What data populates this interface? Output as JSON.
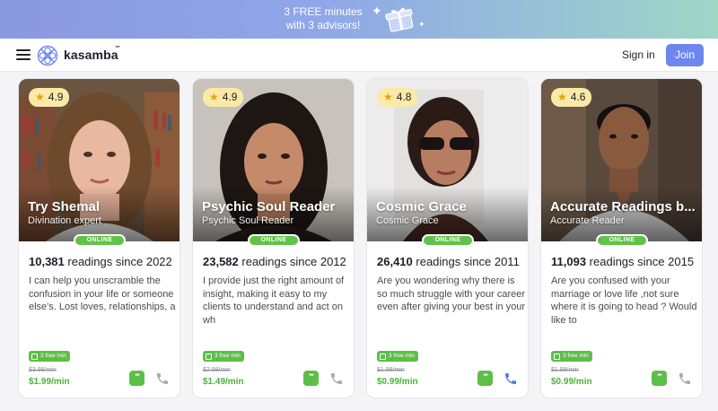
{
  "promo": {
    "line1": "3 FREE minutes",
    "line2": "with 3 advisors!"
  },
  "header": {
    "brand": "kasamba",
    "trademark": "™",
    "signin": "Sign in",
    "join": "Join"
  },
  "online_label": "ONLINE",
  "readings_suffix": "readings since",
  "free_label": "3 free min",
  "colors": {
    "accent": "#6e86ef",
    "online": "#62c14a",
    "price": "#4ab33a",
    "rating_bg": "#fbe9a8",
    "phone_active": "#4f79e8",
    "phone_inactive": "#a7a7ae"
  },
  "advisors": [
    {
      "rating": "4.9",
      "name": "Try Shemal",
      "subtitle": "Divination expert",
      "readings": "10,381",
      "since": "2022",
      "description": "I can help you unscramble the confusion in your life or someone else's. Lost loves, relationships, a",
      "old_price": "$3.99/min",
      "price": "$1.99/min",
      "phone_active": false
    },
    {
      "rating": "4.9",
      "name": "Psychic Soul Reader",
      "subtitle": "Psychic Soul Reader",
      "readings": "23,582",
      "since": "2012",
      "description": "I provide just the right amount of insight, making it easy to my clients to understand and act on wh",
      "old_price": "$2.99/min",
      "price": "$1.49/min",
      "phone_active": false
    },
    {
      "rating": "4.8",
      "name": "Cosmic Grace",
      "subtitle": "Cosmic Grace",
      "readings": "26,410",
      "since": "2011",
      "description": "Are you wondering why there is so much struggle with your career even after giving your best in your",
      "old_price": "$1.99/min",
      "price": "$0.99/min",
      "phone_active": true
    },
    {
      "rating": "4.6",
      "name": "Accurate Readings b...",
      "subtitle": "Accurate Reader",
      "readings": "11,093",
      "since": "2015",
      "description": "Are you confused with your marriage or love life ,not sure where it is going to head ? Would like to",
      "old_price": "$1.99/min",
      "price": "$0.99/min",
      "phone_active": false
    }
  ]
}
